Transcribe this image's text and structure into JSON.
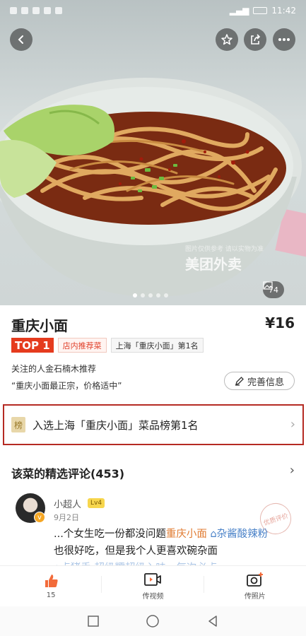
{
  "status_bar": {
    "time": "11:42"
  },
  "hero": {
    "watermark": "美团外卖",
    "watermark_small": "图片仅供参考 请以实物为准",
    "photo_count": "74",
    "dots_count": 5
  },
  "dish": {
    "title": "重庆小面",
    "price": "¥16",
    "top_badge": "TOP 1",
    "tag_store": "店内推荐菜",
    "tag_rank": "上海「重庆小面」第1名",
    "recommend": "关注的人金石楠木推荐",
    "quote": "“重庆小面最正宗，价格适中”",
    "complete_label": "完善信息"
  },
  "ranking": {
    "icon_char": "榜",
    "text": "入选上海「重庆小面」菜品榜第1名"
  },
  "reviews": {
    "header": "该菜的精选评论(453)",
    "item": {
      "name": "小超人",
      "level": "Lv4",
      "date": "9月2日",
      "stamp": "优质评价",
      "line1_prefix": "...个女生吃一份都没问题",
      "line1_highlight": "重庆小面",
      "line1_tag": "杂酱酸辣粉",
      "line2": "也很好吃，但是我个人更喜欢碗杂面",
      "line3": "点猪手 超级糯超级入味，每次必点"
    }
  },
  "actions": [
    {
      "label": "15",
      "icon": "thumbs-up-icon"
    },
    {
      "label": "传视频",
      "icon": "video-upload-icon"
    },
    {
      "label": "传照片",
      "icon": "photo-upload-icon"
    }
  ],
  "colors": {
    "accent_red": "#e53b1e",
    "orange": "#e07a2f",
    "link_blue": "#4a82c8",
    "banner_border": "#b52a23"
  }
}
